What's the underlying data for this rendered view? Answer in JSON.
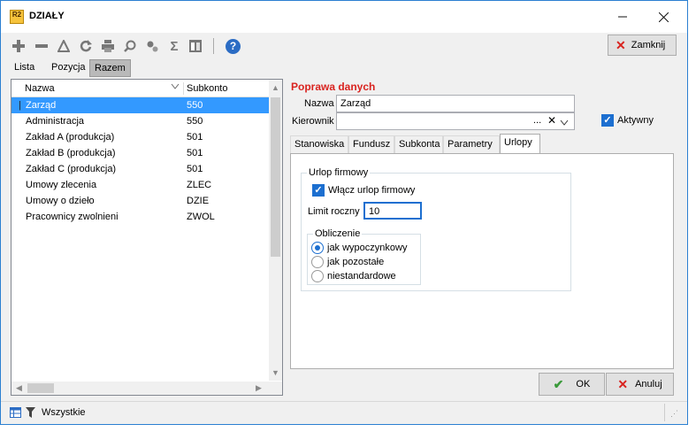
{
  "window": {
    "title": "DZIAŁY",
    "logo": "R2"
  },
  "toolbar": {
    "icons": [
      "plus-icon",
      "minus-icon",
      "warning-triangle-icon",
      "refresh-icon",
      "print-icon",
      "zoom-icon",
      "settings-icon",
      "sum-icon",
      "columns-icon",
      "help-icon"
    ],
    "close_label": "Zamknij"
  },
  "top_tabs": [
    "Lista",
    "Pozycja",
    "Razem"
  ],
  "list": {
    "headers": {
      "name": "Nazwa",
      "account": "Subkonto"
    },
    "rows": [
      {
        "name": "Zarząd",
        "account": "550"
      },
      {
        "name": "Administracja",
        "account": "550"
      },
      {
        "name": "Zakład A (produkcja)",
        "account": "501"
      },
      {
        "name": "Zakład B (produkcja)",
        "account": "501"
      },
      {
        "name": "Zakład C (produkcja)",
        "account": "501"
      },
      {
        "name": "Umowy zlecenia",
        "account": "ZLEC"
      },
      {
        "name": "Umowy o dzieło",
        "account": "DZIE"
      },
      {
        "name": "Pracownicy zwolnieni",
        "account": "ZWOL"
      }
    ],
    "selected_index": 0
  },
  "details": {
    "section_title": "Poprawa danych",
    "name_label": "Nazwa",
    "name_value": "Zarząd",
    "manager_label": "Kierownik",
    "manager_value": "",
    "active_label": "Aktywny",
    "active_checked": true
  },
  "inner_tabs": [
    "Stanowiska",
    "Fundusz",
    "Subkonta",
    "Parametry",
    "Urlopy"
  ],
  "urlopy": {
    "group_title": "Urlop firmowy",
    "enable_label": "Włącz urlop firmowy",
    "enable_checked": true,
    "limit_label": "Limit roczny",
    "limit_value": "10",
    "calc_title": "Obliczenie",
    "options": [
      "jak wypoczynkowy",
      "jak pozostałe",
      "niestandardowe"
    ],
    "selected_option": 0
  },
  "buttons": {
    "ok": "OK",
    "cancel": "Anuluj"
  },
  "status": {
    "filter_label": "Wszystkie"
  },
  "colors": {
    "accent": "#1c6fd0",
    "selection": "#3399ff",
    "title_red": "#d9231f"
  }
}
